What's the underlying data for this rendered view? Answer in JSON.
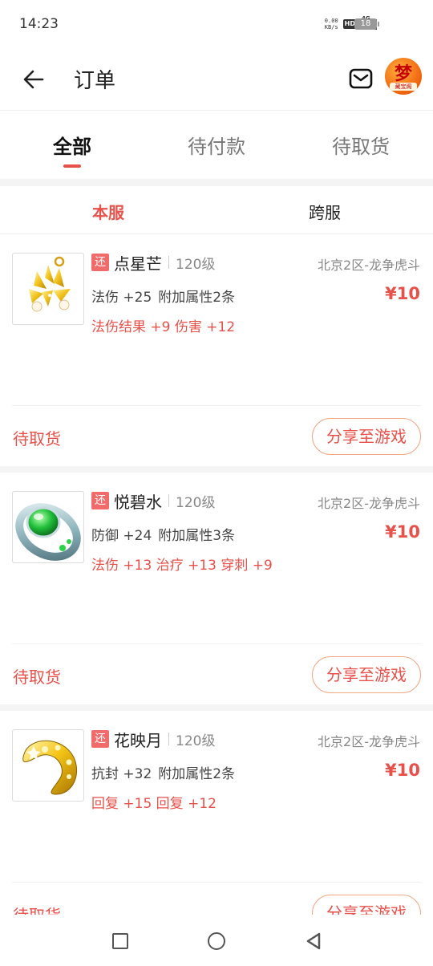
{
  "status_bar": {
    "time": "14:23",
    "net_speed_value": "0.00",
    "net_speed_unit": "KB/s",
    "hd_label": "HD",
    "network_label": "4G",
    "battery": "18"
  },
  "header": {
    "title": "订单",
    "avatar_glyph": "梦",
    "avatar_subtitle": "藏宝阁"
  },
  "tabs": [
    {
      "label": "全部",
      "active": true
    },
    {
      "label": "待付款",
      "active": false
    },
    {
      "label": "待取货",
      "active": false
    }
  ],
  "subtabs": [
    {
      "label": "本服",
      "active": true
    },
    {
      "label": "跨服",
      "active": false
    }
  ],
  "orders": [
    {
      "tag": "还",
      "name": "点星芒",
      "level": "120级",
      "server": "北京2区-龙争虎斗",
      "stat_main": "法伤 +25",
      "stat_extra": "附加属性2条",
      "price": "¥10",
      "bonus": "法伤结果 +9 伤害 +12",
      "status": "待取货",
      "share_label": "分享至游戏",
      "icon": "gold-earring-icon"
    },
    {
      "tag": "还",
      "name": "悦碧水",
      "level": "120级",
      "server": "北京2区-龙争虎斗",
      "stat_main": "防御 +24",
      "stat_extra": "附加属性3条",
      "price": "¥10",
      "bonus": "法伤 +13 治疗 +13 穿刺 +9",
      "status": "待取货",
      "share_label": "分享至游戏",
      "icon": "jade-ring-icon"
    },
    {
      "tag": "还",
      "name": "花映月",
      "level": "120级",
      "server": "北京2区-龙争虎斗",
      "stat_main": "抗封 +32",
      "stat_extra": "附加属性2条",
      "price": "¥10",
      "bonus": "回复 +15 回复 +12",
      "status": "待取货",
      "share_label": "分享至游戏",
      "icon": "gold-bracelet-icon"
    }
  ],
  "colors": {
    "accent": "#e8504a",
    "tag_bg": "#f26b6b",
    "share_border": "#f4a783",
    "separator": "#f4f4f4"
  }
}
